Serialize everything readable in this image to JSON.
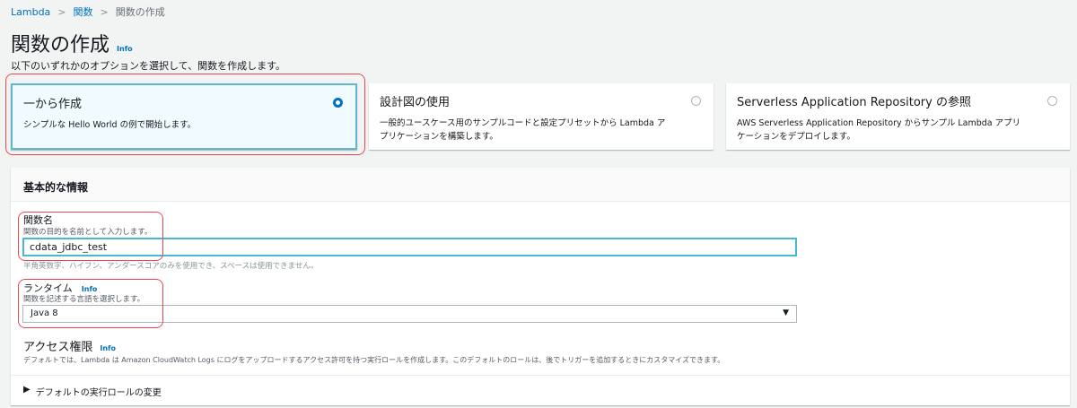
{
  "breadcrumb": [
    "Lambda",
    "関数",
    "関数の作成"
  ],
  "title": "関数の作成",
  "info": "Info",
  "subtitle": "以下のいずれかのオプションを選択して、関数を作成します。",
  "options": [
    {
      "title": "一から作成",
      "desc": "シンプルな Hello World の例で開始します。",
      "selected": true
    },
    {
      "title": "設計図の使用",
      "desc": "一般的ユースケース用のサンプルコードと設定プリセットから Lambda アプリケーションを構築します。",
      "selected": false
    },
    {
      "title": "Serverless Application Repository の参照",
      "desc": "AWS Serverless Application Repository からサンプル Lambda アプリケーションをデプロイします。",
      "selected": false
    }
  ],
  "basic": {
    "header": "基本的な情報",
    "name_label": "関数名",
    "name_desc": "関数の目的を名前として入力します。",
    "name_value": "cdata_jdbc_test",
    "name_hint": "半角英数字、ハイフン、アンダースコアのみを使用でき、スペースは使用できません。",
    "runtime_label": "ランタイム",
    "runtime_desc": "関数を記述する言語を選択します。",
    "runtime_value": "Java 8",
    "access_label": "アクセス権限",
    "access_desc": "デフォルトでは、Lambda は Amazon CloudWatch Logs にログをアップロードするアクセス許可を持つ実行ロールを作成します。このデフォルトのロールは、後でトリガーを追加するときにカスタマイズできます。",
    "role_toggle": "デフォルトの実行ロールの変更"
  }
}
